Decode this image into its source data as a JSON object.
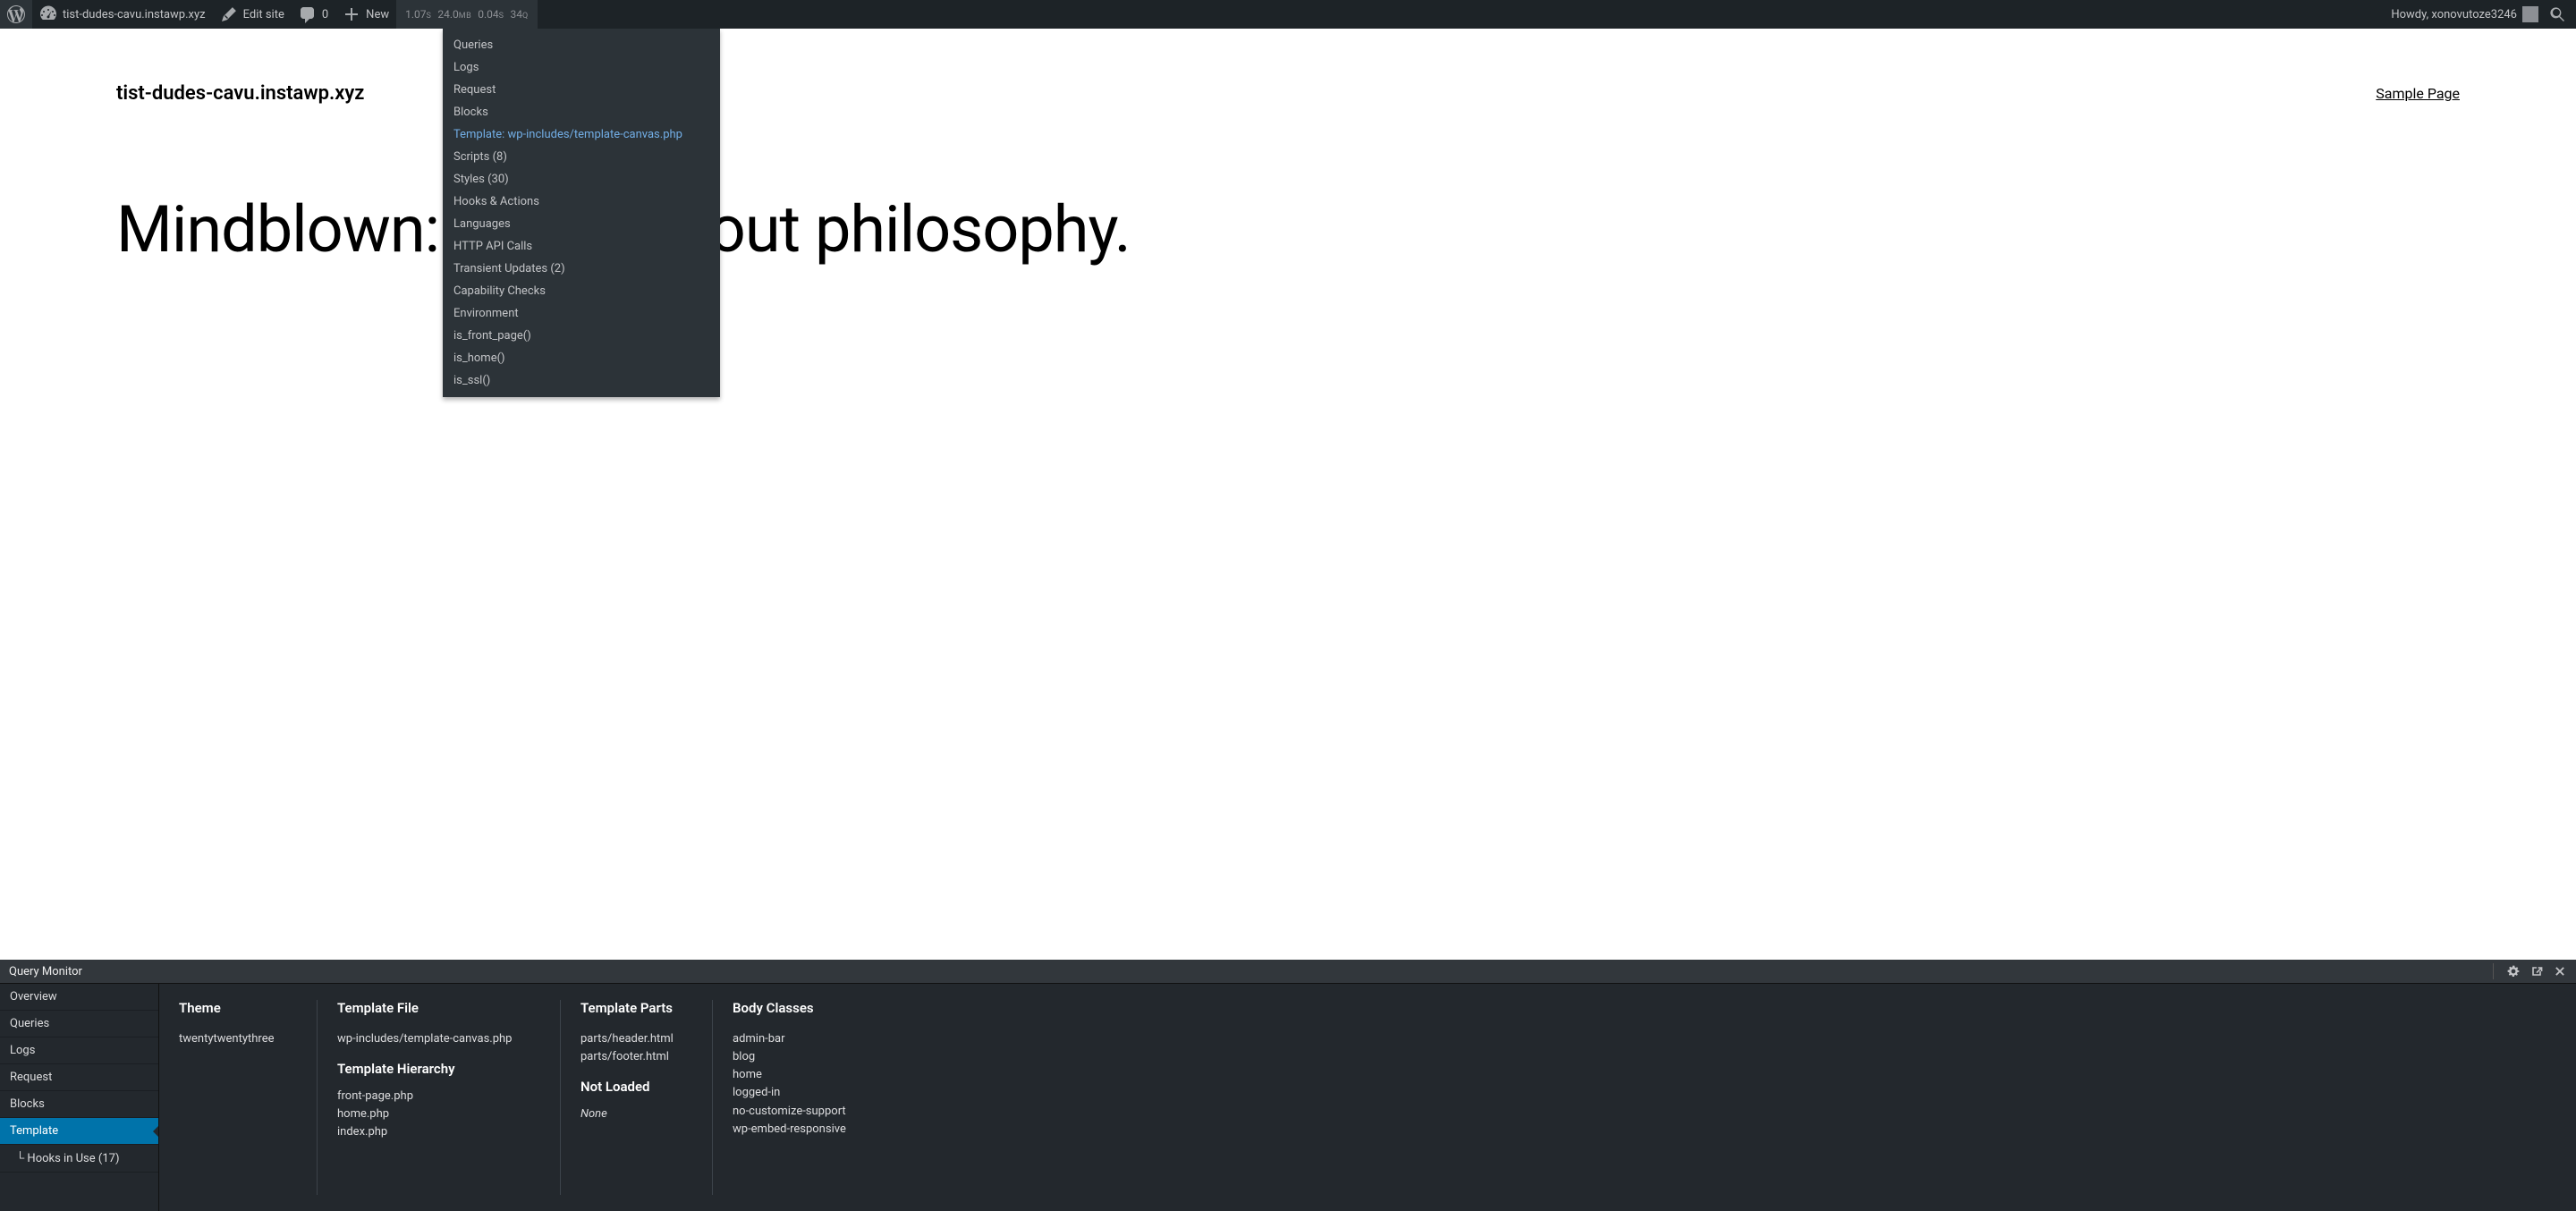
{
  "adminbar": {
    "site_name": "tist-dudes-cavu.instawp.xyz",
    "edit_site": "Edit site",
    "comments_count": "0",
    "new": "New",
    "howdy": "Howdy, xonovutoze3246",
    "qm": {
      "time": "1.07",
      "time_u": "S",
      "mem": "24.0",
      "mem_u": "MB",
      "db": "0.04",
      "db_u": "S",
      "q": "34",
      "q_u": "Q"
    }
  },
  "dropdown": [
    {
      "label": "Queries",
      "active": false
    },
    {
      "label": "Logs",
      "active": false
    },
    {
      "label": "Request",
      "active": false
    },
    {
      "label": "Blocks",
      "active": false
    },
    {
      "label": "Template: wp-includes/template-canvas.php",
      "active": true
    },
    {
      "label": "Scripts (8)",
      "active": false
    },
    {
      "label": "Styles (30)",
      "active": false
    },
    {
      "label": "Hooks & Actions",
      "active": false
    },
    {
      "label": "Languages",
      "active": false
    },
    {
      "label": "HTTP API Calls",
      "active": false
    },
    {
      "label": "Transient Updates (2)",
      "active": false
    },
    {
      "label": "Capability Checks",
      "active": false
    },
    {
      "label": "Environment",
      "active": false
    },
    {
      "label": "is_front_page()",
      "active": false
    },
    {
      "label": "is_home()",
      "active": false
    },
    {
      "label": "is_ssl()",
      "active": false
    }
  ],
  "page": {
    "site_title": "tist-dudes-cavu.instawp.xyz",
    "nav_link": "Sample Page",
    "hero": "Mindblown: a blog about philosophy."
  },
  "qm_panel": {
    "title": "Query Monitor",
    "tabs": [
      {
        "label": "Overview",
        "selected": false
      },
      {
        "label": "Queries",
        "selected": false
      },
      {
        "label": "Logs",
        "selected": false
      },
      {
        "label": "Request",
        "selected": false
      },
      {
        "label": "Blocks",
        "selected": false
      },
      {
        "label": "Template",
        "selected": true
      },
      {
        "label": "└ Hooks in Use (17)",
        "selected": false,
        "sub": true
      }
    ],
    "theme_h": "Theme",
    "theme_name": "twentytwentythree",
    "template_file_h": "Template File",
    "template_file": "wp-includes/template-canvas.php",
    "hierarchy_h": "Template Hierarchy",
    "hierarchy": [
      "front-page.php",
      "home.php",
      "index.php"
    ],
    "parts_h": "Template Parts",
    "parts": [
      "parts/header.html",
      "parts/footer.html"
    ],
    "not_loaded_h": "Not Loaded",
    "not_loaded": "None",
    "body_classes_h": "Body Classes",
    "body_classes": [
      "admin-bar",
      "blog",
      "home",
      "logged-in",
      "no-customize-support",
      "wp-embed-responsive"
    ]
  }
}
